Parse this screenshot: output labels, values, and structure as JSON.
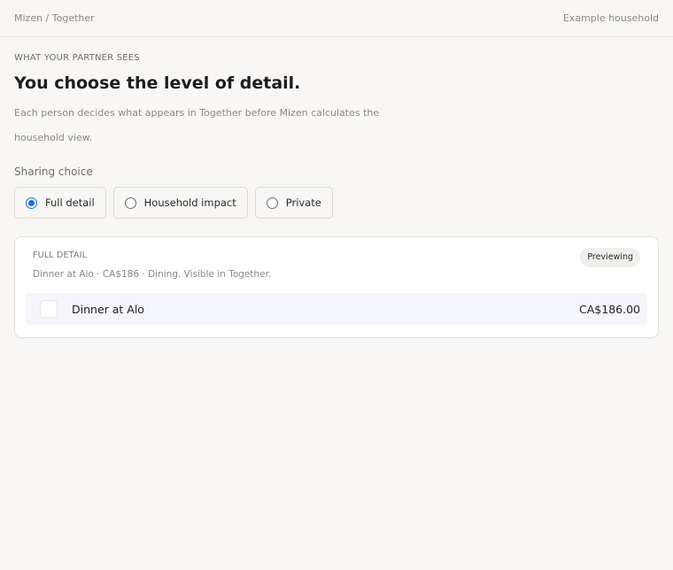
{
  "topbar": {
    "breadcrumb": "Mizen / Together",
    "household": "Example household"
  },
  "section": {
    "eyebrow": "WHAT YOUR PARTNER SEES",
    "headline": "You choose the level of detail.",
    "description": "Each person decides what appears in Together before Mizen calculates the household view."
  },
  "sharing": {
    "label": "Sharing choice",
    "selected": "Full detail",
    "options": [
      {
        "label": "Full detail",
        "checked": true
      },
      {
        "label": "Household impact",
        "checked": false
      },
      {
        "label": "Private",
        "checked": false
      }
    ]
  },
  "preview": {
    "title": "FULL DETAIL",
    "badge": "Previewing",
    "summary": "Dinner at Alo · CA$186 · Dining. Visible in Together.",
    "transaction": {
      "name": "Dinner at Alo",
      "amount": "CA$186.00"
    }
  },
  "colors": {
    "accent": "#1a73e8",
    "background": "#f8f7f5",
    "row_highlight": "#f5f6fb"
  }
}
